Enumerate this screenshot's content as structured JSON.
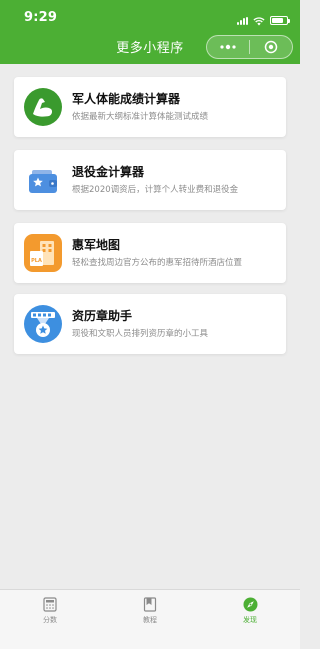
{
  "status": {
    "time": "9:29"
  },
  "nav": {
    "title": "更多小程序"
  },
  "colors": {
    "brand": "#4caf34",
    "background": "#ececec"
  },
  "cards": [
    {
      "icon": "muscle-arm-icon",
      "title": "军人体能成绩计算器",
      "desc": "依据最新大纲标准计算体能测试成绩"
    },
    {
      "icon": "wallet-icon",
      "title": "退役金计算器",
      "desc": "根据2020调资后，计算个人转业费和退役金"
    },
    {
      "icon": "hotel-map-icon",
      "title": "惠军地图",
      "desc": "轻松查找周边官方公布的惠军招待所酒店位置"
    },
    {
      "icon": "medal-icon",
      "title": "资历章助手",
      "desc": "现役和文职人员排列资历章的小工具"
    }
  ],
  "tabbar": [
    {
      "icon": "calculator-icon",
      "label": "分数",
      "active": false
    },
    {
      "icon": "book-icon",
      "label": "教程",
      "active": false
    },
    {
      "icon": "compass-icon",
      "label": "发现",
      "active": true
    }
  ]
}
